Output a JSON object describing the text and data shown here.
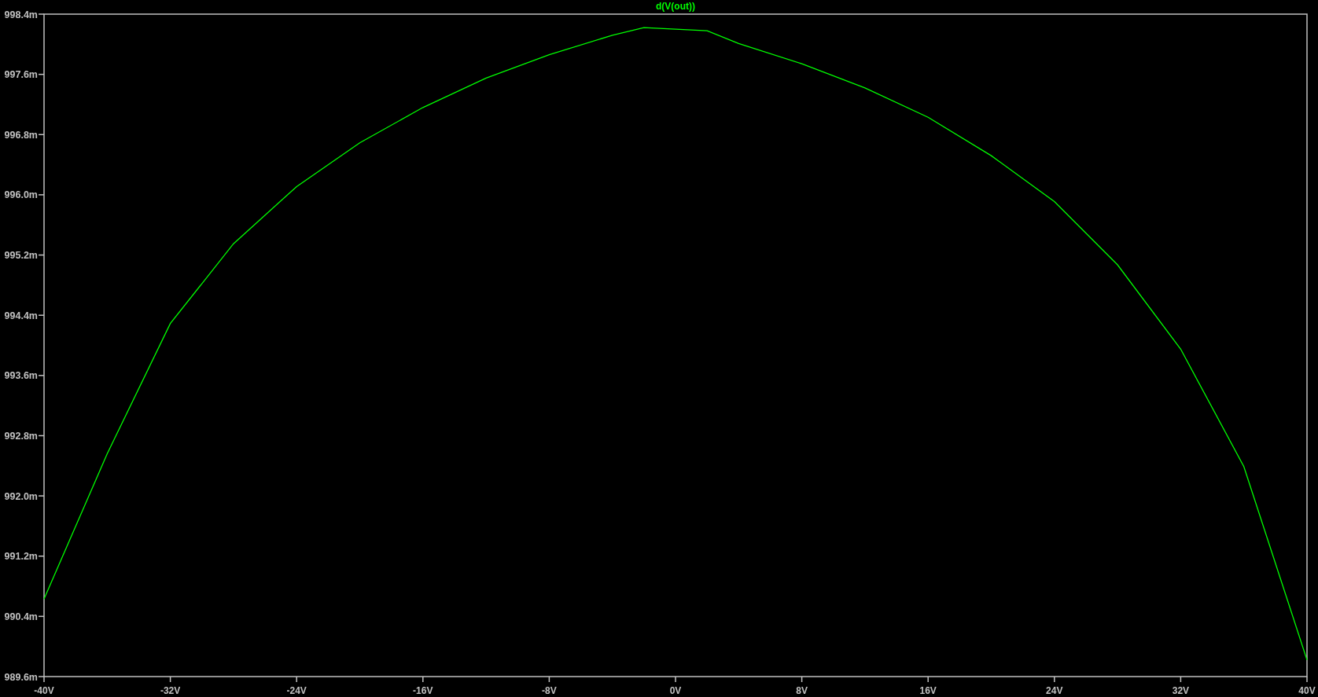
{
  "chart_data": {
    "type": "line",
    "x": [
      -40,
      -36,
      -32,
      -28,
      -24,
      -20,
      -16,
      -12,
      -8,
      -4,
      -2,
      0,
      2,
      4,
      8,
      12,
      16,
      20,
      24,
      28,
      32,
      36,
      40
    ],
    "series": [
      {
        "name": "d(V(out))",
        "color": "#00ff00",
        "values": [
          990.63,
          992.56,
          994.29,
          995.35,
          996.11,
          996.69,
          997.16,
          997.55,
          997.86,
          998.12,
          998.22,
          998.2,
          998.18,
          998.01,
          997.74,
          997.42,
          997.03,
          996.52,
          995.91,
          995.07,
          993.95,
          992.39,
          989.82
        ]
      }
    ],
    "xlim": [
      -40,
      40
    ],
    "ylim": [
      989.6,
      998.4
    ],
    "xticks": [
      {
        "value": -40,
        "label": "-40V"
      },
      {
        "value": -32,
        "label": "-32V"
      },
      {
        "value": -24,
        "label": "-24V"
      },
      {
        "value": -16,
        "label": "-16V"
      },
      {
        "value": -8,
        "label": "-8V"
      },
      {
        "value": 0,
        "label": "0V"
      },
      {
        "value": 8,
        "label": "8V"
      },
      {
        "value": 16,
        "label": "16V"
      },
      {
        "value": 24,
        "label": "24V"
      },
      {
        "value": 32,
        "label": "32V"
      },
      {
        "value": 40,
        "label": "40V"
      }
    ],
    "yticks": [
      {
        "value": 998.4,
        "label": "998.4m"
      },
      {
        "value": 997.6,
        "label": "997.6m"
      },
      {
        "value": 996.8,
        "label": "996.8m"
      },
      {
        "value": 996.0,
        "label": "996.0m"
      },
      {
        "value": 995.2,
        "label": "995.2m"
      },
      {
        "value": 994.4,
        "label": "994.4m"
      },
      {
        "value": 993.6,
        "label": "993.6m"
      },
      {
        "value": 992.8,
        "label": "992.8m"
      },
      {
        "value": 992.0,
        "label": "992.0m"
      },
      {
        "value": 991.2,
        "label": "991.2m"
      },
      {
        "value": 990.4,
        "label": "990.4m"
      },
      {
        "value": 989.6,
        "label": "989.6m"
      }
    ]
  }
}
